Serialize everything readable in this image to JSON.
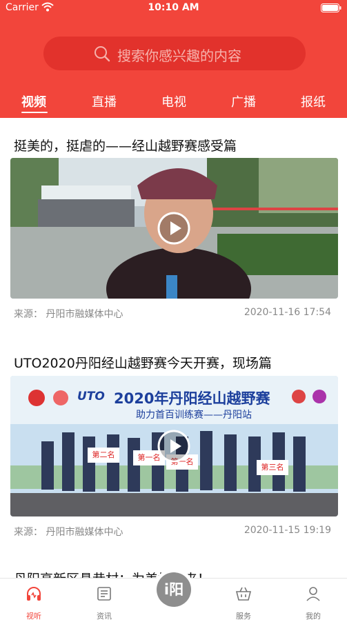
{
  "status_bar": {
    "carrier": "Carrier",
    "time": "10:10 AM"
  },
  "search": {
    "placeholder": "搜索你感兴趣的内容",
    "icon": "search-icon"
  },
  "tabs": [
    {
      "label": "视频",
      "active": true
    },
    {
      "label": "直播"
    },
    {
      "label": "电视"
    },
    {
      "label": "广播"
    },
    {
      "label": "报纸"
    }
  ],
  "feed": [
    {
      "title": "挺美的，挺虐的——经山越野赛感受篇",
      "source": "来源：  丹阳市融媒体中心",
      "time": "2020-11-16 17:54"
    },
    {
      "title": "UTO2020丹阳经山越野赛今天开赛，现场篇",
      "source": "来源：  丹阳市融媒体中心",
      "time": "2020-11-15 19:19",
      "banner_title": "2020年丹阳经山越野赛",
      "banner_brand": "UTO",
      "banner_subtitle": "助力首百训练赛——丹阳站",
      "placards": [
        "第二名",
        "第一名",
        "第一名",
        "第三名"
      ]
    },
    {
      "title": "丹阳高新区悬巷村：为美好而来！"
    }
  ],
  "tabbar": {
    "items": [
      {
        "label": "视听",
        "icon": "headphones-icon",
        "active": true
      },
      {
        "label": "资讯",
        "icon": "news-icon"
      },
      {
        "label": "i阳",
        "icon": "center-logo"
      },
      {
        "label": "服务",
        "icon": "basket-icon"
      },
      {
        "label": "我的",
        "icon": "user-icon"
      }
    ]
  },
  "colors": {
    "brand": "#f2453b",
    "search_bg": "#e2322c",
    "active_tab": "#f2453b",
    "meta_text": "#888888"
  }
}
